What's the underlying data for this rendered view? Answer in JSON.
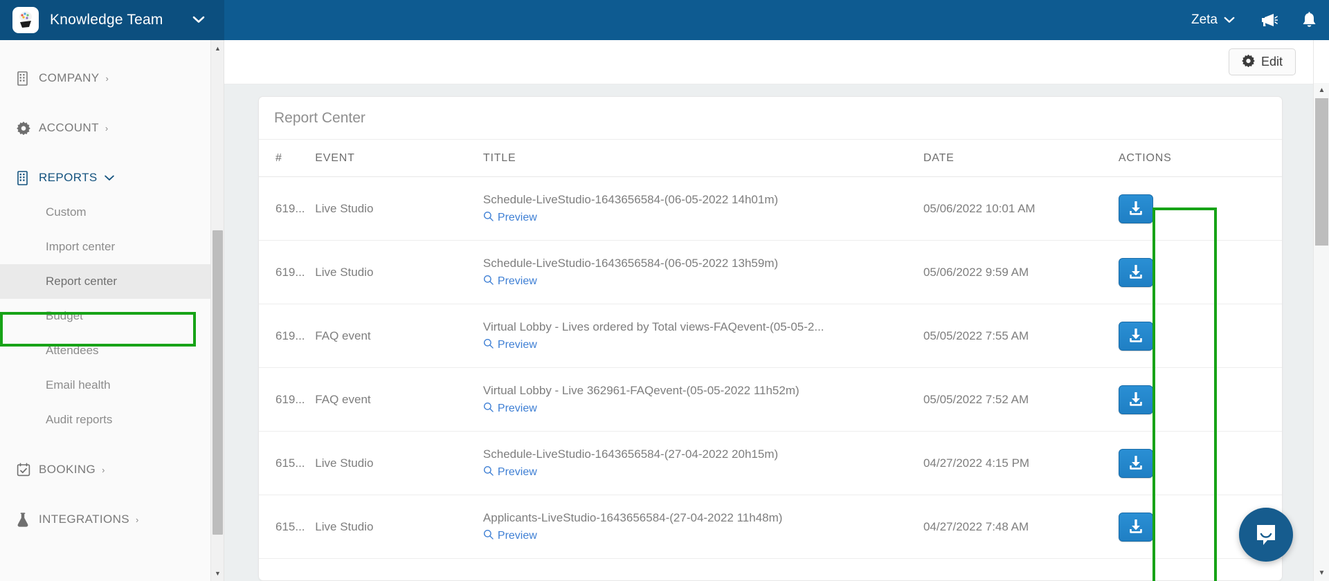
{
  "topbar": {
    "team_name": "Knowledge Team",
    "team_caret_icon": "chevron-down-icon",
    "logo_icon": "team-avatar-icon",
    "user_name": "Zeta",
    "user_caret_icon": "chevron-down-icon",
    "announcement_icon": "megaphone-icon",
    "notifications_icon": "bell-icon",
    "bg_color": "#0e5b91"
  },
  "sidebar": {
    "groups": [
      {
        "label": "COMPANY",
        "icon": "building-icon",
        "chevron": "›",
        "active": false
      },
      {
        "label": "ACCOUNT",
        "icon": "gear-icon",
        "chevron": "›",
        "active": false
      },
      {
        "label": "REPORTS",
        "icon": "building-icon",
        "chevron": "∨",
        "active": true
      }
    ],
    "reports_items": [
      {
        "label": "Custom",
        "selected": false
      },
      {
        "label": "Import center",
        "selected": false
      },
      {
        "label": "Report center",
        "selected": true
      },
      {
        "label": "Budget",
        "selected": false
      },
      {
        "label": "Attendees",
        "selected": false
      },
      {
        "label": "Email health",
        "selected": false
      },
      {
        "label": "Audit reports",
        "selected": false
      }
    ],
    "bottom_groups": [
      {
        "label": "BOOKING",
        "icon": "calendar-check-icon",
        "chevron": "›"
      },
      {
        "label": "INTEGRATIONS",
        "icon": "flask-icon",
        "chevron": "›"
      }
    ],
    "highlight_color": "#17a317",
    "scrollbar": {
      "up_arrow": "▲",
      "down_arrow": "▼"
    }
  },
  "toolbar": {
    "edit_label": "Edit",
    "edit_icon": "gear-icon"
  },
  "card": {
    "title": "Report Center",
    "columns": [
      "#",
      "EVENT",
      "TITLE",
      "DATE",
      "ACTIONS"
    ],
    "preview_label": "Preview",
    "preview_icon": "magnifier-icon",
    "download_icon": "download-icon",
    "row_accent_color": "#3cc357",
    "download_button_color": "#2180c4",
    "rows": [
      {
        "id": "619...",
        "event": "Live Studio",
        "title": "Schedule-LiveStudio-1643656584-(06-05-2022 14h01m)",
        "date": "05/06/2022 10:01 AM"
      },
      {
        "id": "619...",
        "event": "Live Studio",
        "title": "Schedule-LiveStudio-1643656584-(06-05-2022 13h59m)",
        "date": "05/06/2022 9:59 AM"
      },
      {
        "id": "619...",
        "event": "FAQ event",
        "title": "Virtual Lobby - Lives ordered by Total views-FAQevent-(05-05-2...",
        "date": "05/05/2022 7:55 AM"
      },
      {
        "id": "619...",
        "event": "FAQ event",
        "title": "Virtual Lobby - Live 362961-FAQevent-(05-05-2022 11h52m)",
        "date": "05/05/2022 7:52 AM"
      },
      {
        "id": "615...",
        "event": "Live Studio",
        "title": "Schedule-LiveStudio-1643656584-(27-04-2022 20h15m)",
        "date": "04/27/2022 4:15 PM"
      },
      {
        "id": "615...",
        "event": "Live Studio",
        "title": "Applicants-LiveStudio-1643656584-(27-04-2022 11h48m)",
        "date": "04/27/2022 7:48 AM"
      }
    ]
  },
  "chat": {
    "icon": "chat-bubble-icon",
    "color": "#165c8e"
  },
  "window_scrollbar": {
    "up_arrow": "▲",
    "down_arrow": "▼"
  }
}
